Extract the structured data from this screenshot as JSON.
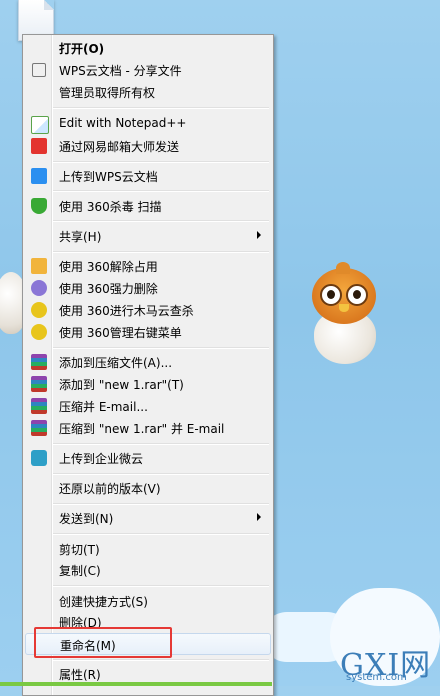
{
  "menu": {
    "items": [
      {
        "label": "打开(O)",
        "bold": true,
        "icon": "none"
      },
      {
        "label": "WPS云文档 - 分享文件",
        "icon": "share-icon"
      },
      {
        "label": "管理员取得所有权",
        "icon": "none"
      },
      {
        "label": "Edit with Notepad++",
        "icon": "notepad-icon"
      },
      {
        "label": "通过网易邮箱大师发送",
        "icon": "mail-master-icon"
      },
      {
        "label": "上传到WPS云文档",
        "icon": "wps-upload-icon"
      },
      {
        "label": "使用 360杀毒 扫描",
        "icon": "360-shield-icon"
      },
      {
        "label": "共享(H)",
        "icon": "none",
        "submenu": true
      },
      {
        "label": "使用 360解除占用",
        "icon": "360-unlock-icon"
      },
      {
        "label": "使用 360强力删除",
        "icon": "360-delete-icon"
      },
      {
        "label": "使用 360进行木马云查杀",
        "icon": "360-plus-icon"
      },
      {
        "label": "使用 360管理右键菜单",
        "icon": "360-plus-icon"
      },
      {
        "label": "添加到压缩文件(A)...",
        "icon": "winrar-icon"
      },
      {
        "label": "添加到 \"new 1.rar\"(T)",
        "icon": "winrar-icon"
      },
      {
        "label": "压缩并 E-mail...",
        "icon": "winrar-icon"
      },
      {
        "label": "压缩到 \"new 1.rar\" 并 E-mail",
        "icon": "winrar-icon"
      },
      {
        "label": "上传到企业微云",
        "icon": "weiyun-icon"
      },
      {
        "label": "还原以前的版本(V)",
        "icon": "none"
      },
      {
        "label": "发送到(N)",
        "icon": "none",
        "submenu": true
      },
      {
        "label": "剪切(T)",
        "icon": "none"
      },
      {
        "label": "复制(C)",
        "icon": "none"
      },
      {
        "label": "创建快捷方式(S)",
        "icon": "none"
      },
      {
        "label": "删除(D)",
        "icon": "none"
      },
      {
        "label": "重命名(M)",
        "icon": "none",
        "highlighted": true
      },
      {
        "label": "属性(R)",
        "icon": "none"
      }
    ]
  },
  "watermark": {
    "logo": "GXI网",
    "sub": "system.com"
  },
  "colors": {
    "menu_bg": "#f0f0f0",
    "highlight_border": "#e53935",
    "desktop": "#9fd0ef"
  }
}
